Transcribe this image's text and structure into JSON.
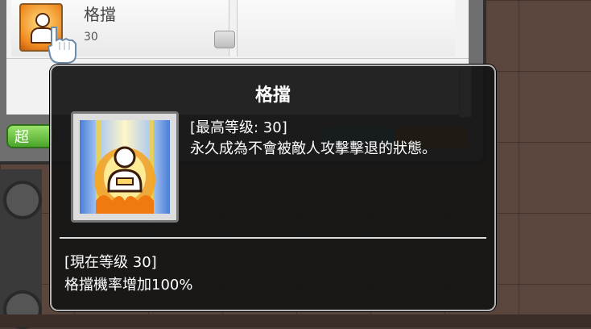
{
  "skill_window": {
    "skill_name": "格擋",
    "skill_level": "30",
    "tab_label": "超"
  },
  "tooltip": {
    "title": "格擋",
    "max_level": "[最高等级: 30]",
    "description": "永久成為不會被敵人攻擊擊退的狀態。",
    "current_level": "[現在等级 30]",
    "current_effect": "格擋機率增加100%"
  },
  "icons": {
    "skill_row_icon": "block-skill-icon",
    "tooltip_icon": "block-skill-icon",
    "cursor": "hand-pointer-icon",
    "level_up": "level-up-icon"
  }
}
